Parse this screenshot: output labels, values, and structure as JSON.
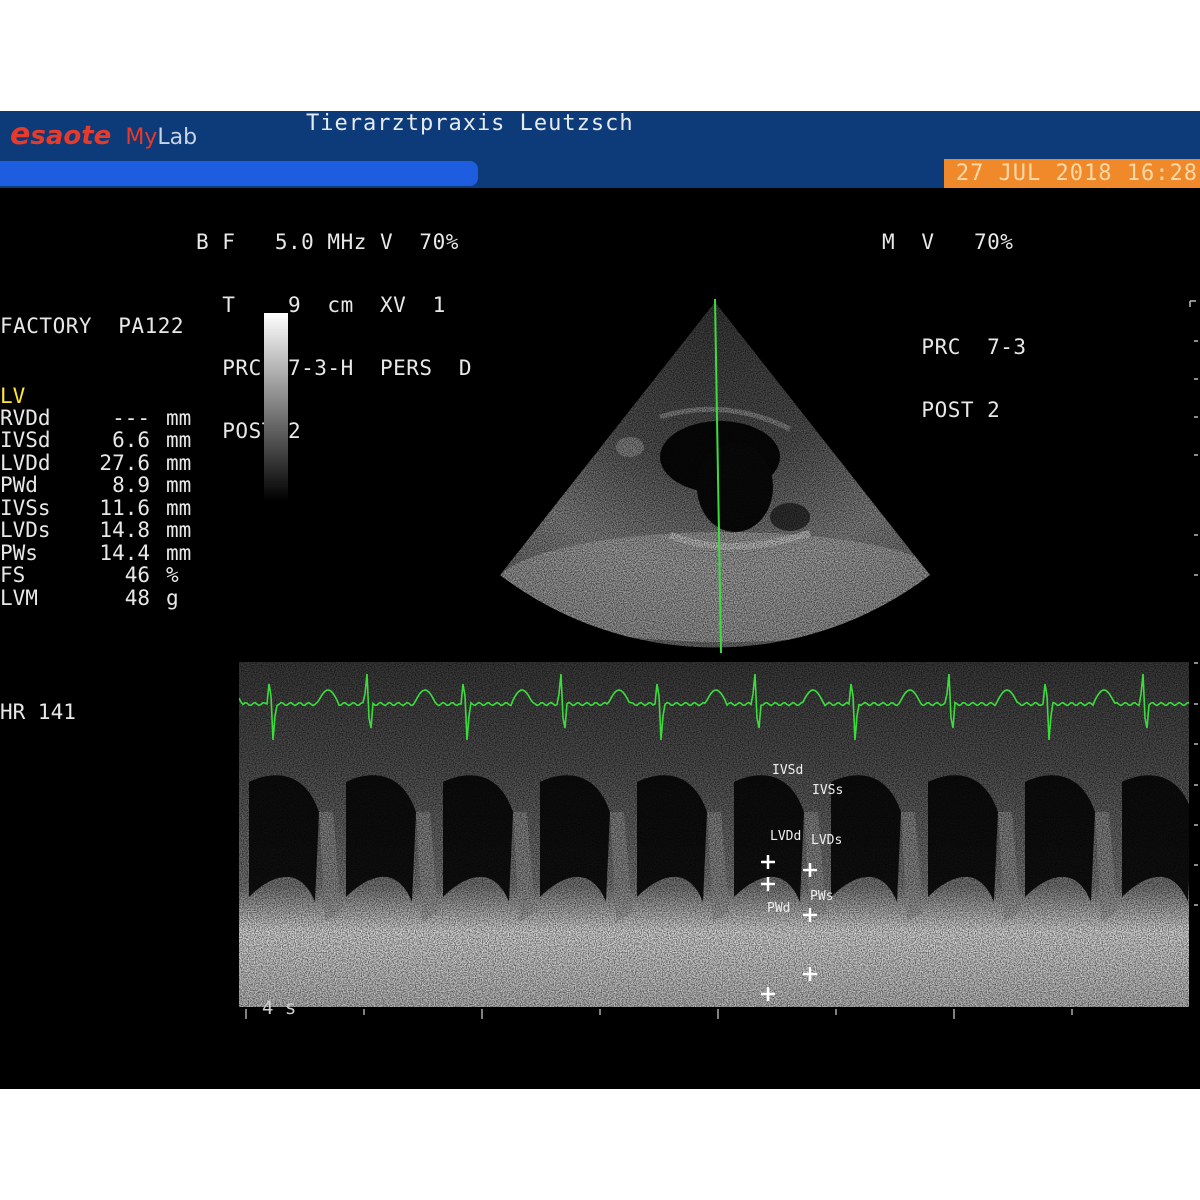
{
  "header": {
    "brand_e": "e",
    "brand_saote": "saote",
    "brand_my": "My",
    "brand_lab": "Lab",
    "clinic": "Tierarztpraxis Leutzsch",
    "datetime": "27 JUL 2018 16:28",
    "colors": {
      "bar": "#0d3a78",
      "progress": "#1f5de0",
      "date_bg": "#f0892a",
      "brand": "#e83a2a"
    }
  },
  "b_mode": {
    "lines": [
      "B F   5.0 MHz V  70%",
      "  T    9  cm  XV  1",
      "  PRC  7-3-H  PERS  D",
      "  POST 2"
    ]
  },
  "m_mode": {
    "lines": [
      "M  V   70%",
      "",
      "   PRC  7-3",
      "   POST 2"
    ]
  },
  "preset": "FACTORY  PA122",
  "section_label": "LV",
  "section_color": "#ffe833",
  "measurements": [
    {
      "label": "RVDd",
      "value": "---",
      "unit": "mm"
    },
    {
      "label": "IVSd",
      "value": "6.6",
      "unit": "mm"
    },
    {
      "label": "LVDd",
      "value": "27.6",
      "unit": "mm"
    },
    {
      "label": "PWd",
      "value": "8.9",
      "unit": "mm"
    },
    {
      "label": "IVSs",
      "value": "11.6",
      "unit": "mm"
    },
    {
      "label": "LVDs",
      "value": "14.8",
      "unit": "mm"
    },
    {
      "label": "PWs",
      "value": "14.4",
      "unit": "mm"
    },
    {
      "label": "FS",
      "value": "46",
      "unit": "%"
    },
    {
      "label": "LVM",
      "value": "48",
      "unit": "g"
    }
  ],
  "heart_rate": "HR 141",
  "time_scale": "4 s",
  "calipers": {
    "ivsd": "IVSd",
    "ivss": "IVSs",
    "lvdd": "LVDd",
    "lvds": "LVDs",
    "pwd": "PWd",
    "pws": "PWs"
  },
  "icons": {
    "caliper": "plus-cross-icon",
    "focus_marker": "circle-marker-icon"
  },
  "trace_color": "#3ddc3d"
}
